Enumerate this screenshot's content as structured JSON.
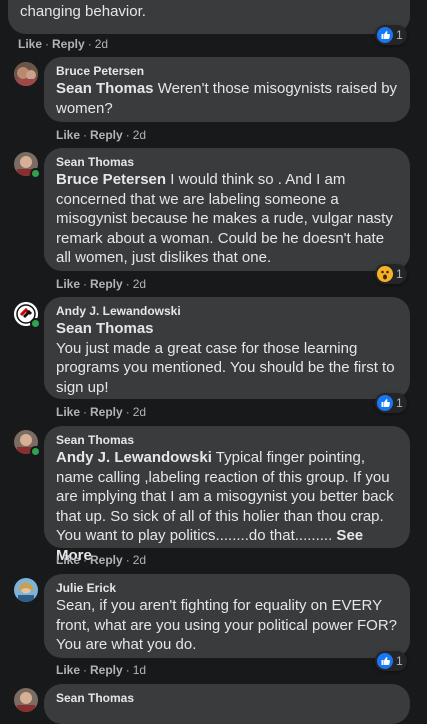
{
  "comments": [
    {
      "text": "changing behavior.",
      "actions": {
        "like": "Like",
        "reply": "Reply",
        "time": "2d"
      },
      "reaction": {
        "icon": "like-icon",
        "count": "1"
      }
    },
    {
      "author": "Bruce Petersen",
      "mention": "Sean Thomas",
      "text": " Weren't those misogynists raised by women?",
      "actions": {
        "like": "Like",
        "reply": "Reply",
        "time": "2d"
      }
    },
    {
      "author": "Sean Thomas",
      "mention": "Bruce Petersen",
      "text": " I would think so . And I am concerned that we are labeling someone a misogynist because he makes a rude, vulgar nasty remark about a woman. Could be he doesn't hate all women, just dislikes that one.",
      "actions": {
        "like": "Like",
        "reply": "Reply",
        "time": "2d"
      },
      "reaction": {
        "icon": "wow-icon",
        "count": "1"
      }
    },
    {
      "author": "Andy J. Lewandowski",
      "mention": "Sean Thomas",
      "text": "You just made a great case for those learning programs you mentioned. You should be the first to sign up!",
      "actions": {
        "like": "Like",
        "reply": "Reply",
        "time": "2d"
      },
      "reaction": {
        "icon": "like-icon",
        "count": "1"
      }
    },
    {
      "author": "Sean Thomas",
      "mention": "Andy J. Lewandowski",
      "text": " Typical finger pointing, name calling ,labeling reaction of this group. If you are implying that I am a misogynist you better back that up. So sick of all of this holier than thou crap. You want to play politics........do that.........",
      "see_more": " See More",
      "actions": {
        "like": "Like",
        "reply": "Reply",
        "time": "2d"
      }
    },
    {
      "author": "Julie Erick",
      "text": "Sean, if you aren't fighting for equality on EVERY front, what are you using your political power FOR? You are what you do.",
      "actions": {
        "like": "Like",
        "reply": "Reply",
        "time": "1d"
      },
      "reaction": {
        "icon": "like-icon",
        "count": "1"
      }
    },
    {
      "author": "Sean Thomas"
    }
  ],
  "separator": "·",
  "colors": {
    "background": "#18191a",
    "bubble": "#3a3b3c",
    "like_blue": "#1877f2",
    "wow_yellow": "#f7b125",
    "online_green": "#31a24c"
  }
}
